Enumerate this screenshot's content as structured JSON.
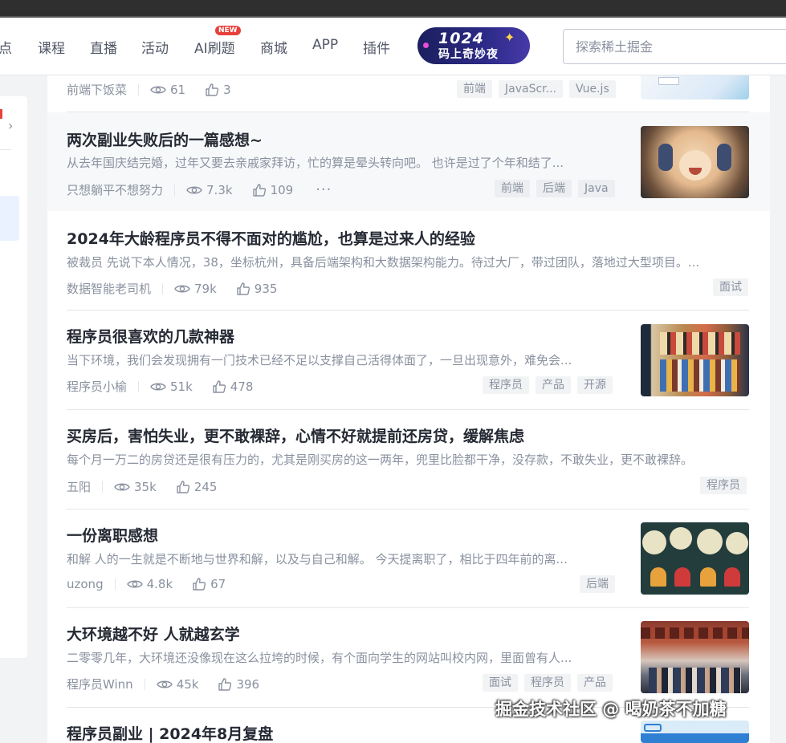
{
  "nav": {
    "items": [
      {
        "label": "点"
      },
      {
        "label": "课程"
      },
      {
        "label": "直播"
      },
      {
        "label": "活动"
      },
      {
        "label": "AI刷题",
        "badge": "NEW"
      },
      {
        "label": "商城"
      },
      {
        "label": "APP"
      },
      {
        "label": "插件"
      }
    ],
    "promo": {
      "year": "1024",
      "text": "码上奇妙夜"
    }
  },
  "search": {
    "placeholder": "探索稀土掘金"
  },
  "articles": [
    {
      "author": "前端下饭菜",
      "views": "61",
      "likes": "3",
      "tags": [
        "前端",
        "JavaScr...",
        "Vue.js"
      ]
    },
    {
      "title": "两次副业失败后的一篇感想~",
      "excerpt": "从去年国庆结完婚，过年又要去亲戚家拜访，忙的算是晕头转向吧。 也许是过了个年和结了...",
      "author": "只想躺平不想努力",
      "views": "7.3k",
      "likes": "109",
      "more": "···",
      "tags": [
        "前端",
        "后端",
        "Java"
      ]
    },
    {
      "title": "2024年大龄程序员不得不面对的尴尬，也算是过来人的经验",
      "excerpt": "被裁员 先说下本人情况，38，坐标杭州，具备后端架构和大数据架构能力。待过大厂，带过团队，落地过大型项目。...",
      "author": "数据智能老司机",
      "views": "79k",
      "likes": "935",
      "tags": [
        "面试"
      ]
    },
    {
      "title": "程序员很喜欢的几款神器",
      "excerpt": "当下环境，我们会发现拥有一门技术已经不足以支撑自己活得体面了，一旦出现意外，难免会...",
      "author": "程序员小榆",
      "views": "51k",
      "likes": "478",
      "tags": [
        "程序员",
        "产品",
        "开源"
      ]
    },
    {
      "title": "买房后，害怕失业，更不敢裸辞，心情不好就提前还房贷，缓解焦虑",
      "excerpt": "每个月一万二的房贷还是很有压力的，尤其是刚买房的这一两年，兜里比脸都干净，没存款，不敢失业，更不敢裸辞。",
      "author": "五阳",
      "views": "35k",
      "likes": "245",
      "tags": [
        "程序员"
      ]
    },
    {
      "title": "一份离职感想",
      "excerpt": "和解 人的一生就是不断地与世界和解，以及与自己和解。 今天提离职了，相比于四年前的离...",
      "author": "uzong",
      "views": "4.8k",
      "likes": "67",
      "tags": [
        "后端"
      ]
    },
    {
      "title": "大环境越不好 人就越玄学",
      "excerpt": "二零零几年，大环境还没像现在这么拉垮的时候，有个面向学生的网站叫校内网，里面曾有人...",
      "author": "程序员Winn",
      "views": "45k",
      "likes": "396",
      "tags": [
        "面试",
        "程序员",
        "产品"
      ]
    },
    {
      "title": "程序员副业 | 2024年8月复盘"
    }
  ],
  "watermark": "掘金技术社区 @ 喝奶茶不加糖",
  "colors": {
    "accent": "#1e80ff",
    "text": "#252933",
    "muted": "#8a919f",
    "badge": "#e8403a"
  }
}
